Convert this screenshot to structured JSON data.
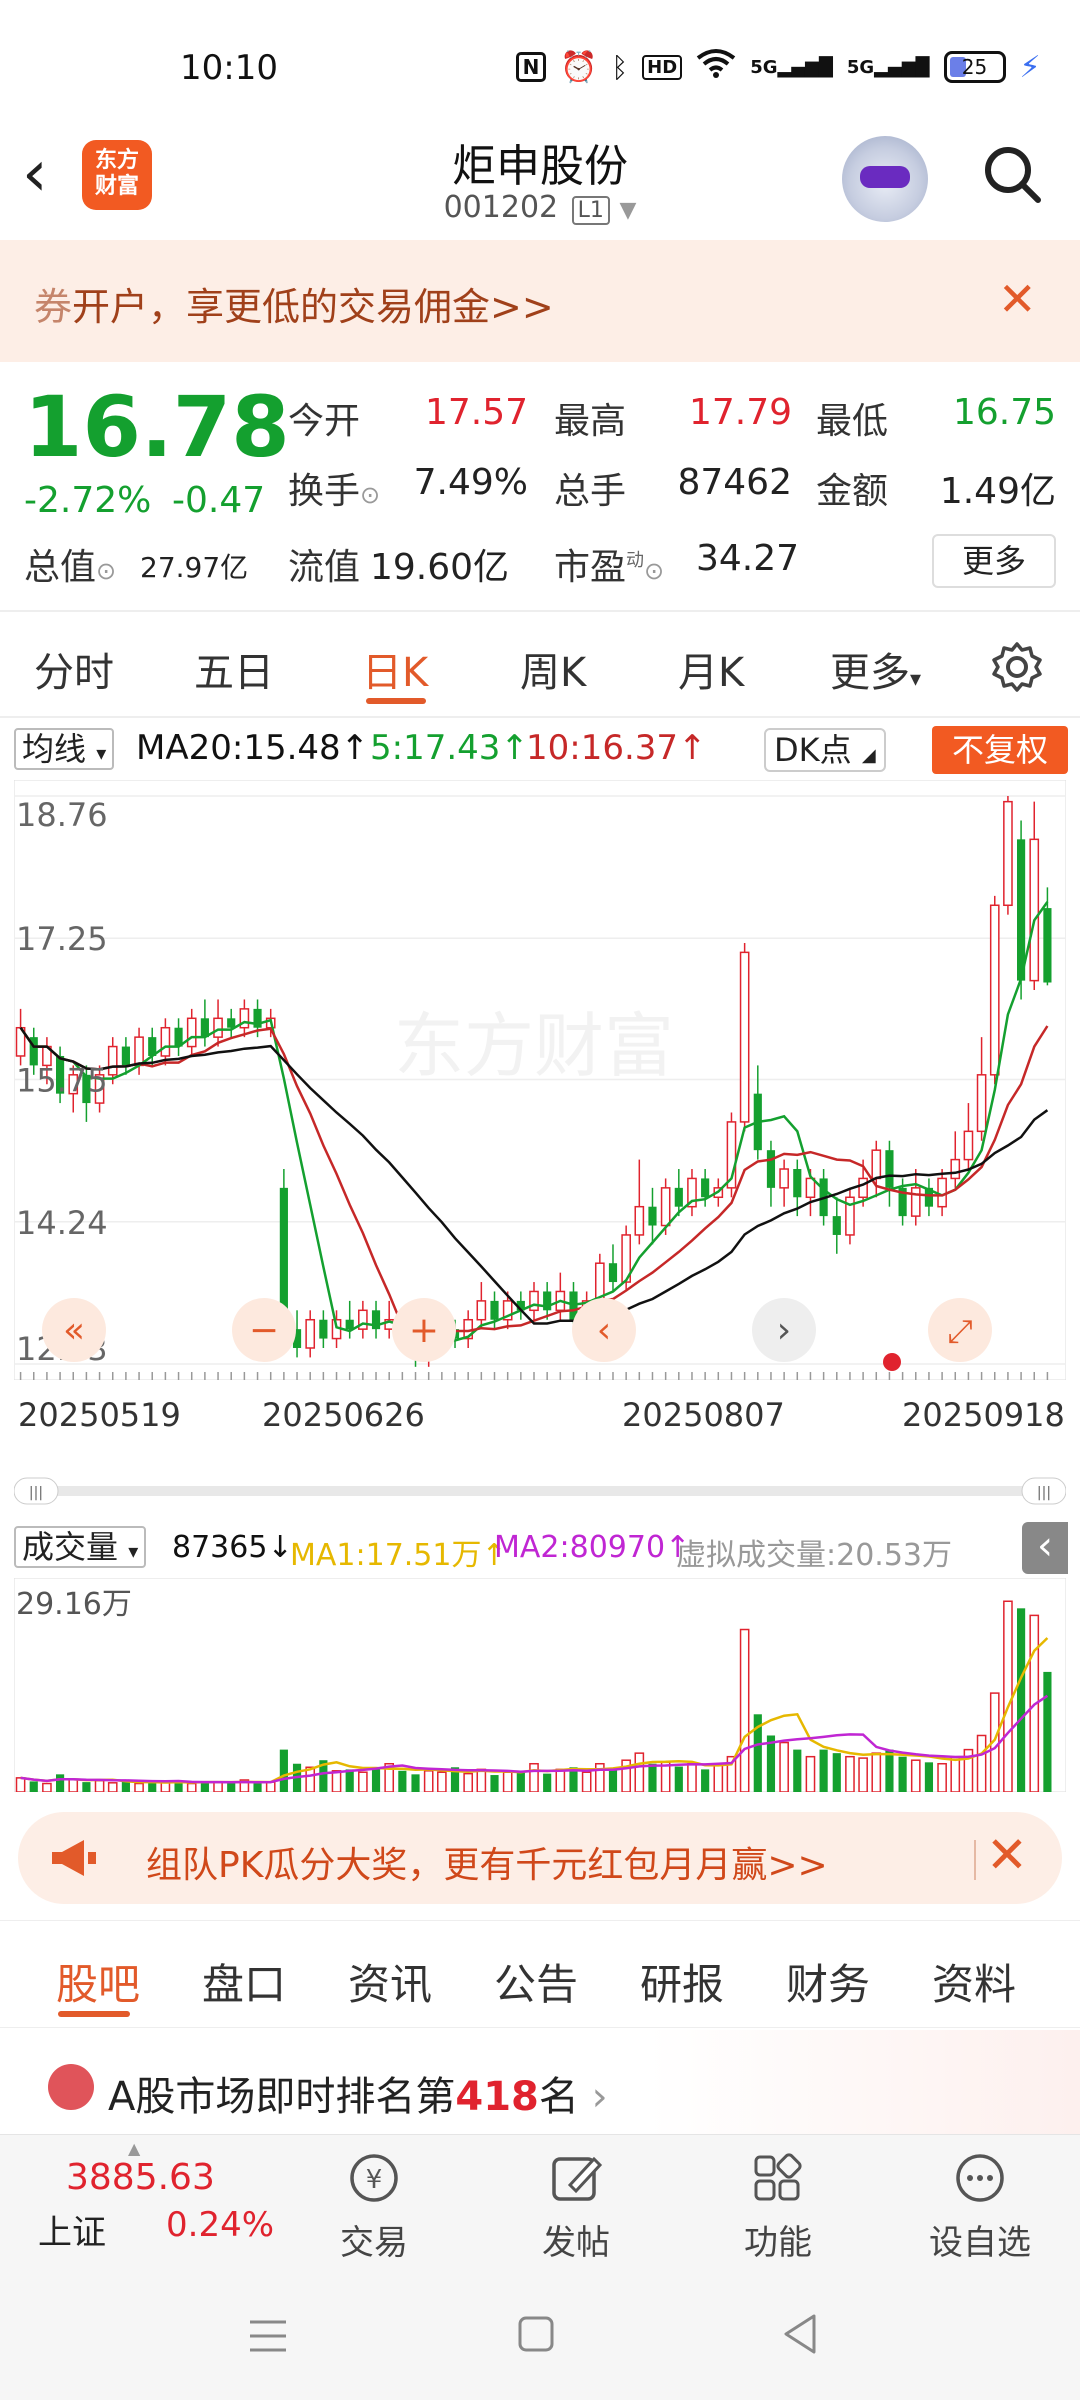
{
  "status_bar": {
    "time": "10:10",
    "battery": "25",
    "network": "5G"
  },
  "header": {
    "back_icon": "chevron-left-icon",
    "logo_text": [
      "东方",
      "财富"
    ],
    "stock_name": "炬申股份",
    "stock_code": "001202",
    "level_badge": "L1",
    "search_icon": "search-icon"
  },
  "banner": {
    "text": "开户，享更低的交易佣金>>",
    "prefix": "券"
  },
  "quote": {
    "price": "16.78",
    "change_pct": "-2.72%",
    "change_abs": "-0.47",
    "open_label": "今开",
    "open": "17.57",
    "high_label": "最高",
    "high": "17.79",
    "low_label": "最低",
    "low": "16.75",
    "turnover_label": "换手",
    "turnover": "7.49%",
    "volume_label": "总手",
    "volume": "87462",
    "amount_label": "金额",
    "amount": "1.49亿",
    "mktcap_label": "总值",
    "mktcap": "27.97亿",
    "float_label": "流值",
    "float": "19.60亿",
    "pe_label": "市盈",
    "pe_sup": "动",
    "pe": "34.27",
    "more_label": "更多"
  },
  "period_tabs": [
    "分时",
    "五日",
    "日K",
    "周K",
    "月K",
    "更多"
  ],
  "active_tab": "日K",
  "ma_bar": {
    "selector": "均线",
    "ma20": "MA20:15.48",
    "ma5": "5:17.43",
    "ma10": "10:16.37",
    "dk": "DK点",
    "adjust": "不复权"
  },
  "kline_axis": {
    "y_labels": [
      "18.76",
      "17.25",
      "15.75",
      "14.24",
      "12.73"
    ],
    "x_labels": [
      "20250519",
      "20250626",
      "20250807",
      "20250918"
    ],
    "watermark": "东方财富"
  },
  "volume_bar": {
    "selector": "成交量",
    "vol": "87365",
    "ma1": "MA1:17.51万",
    "ma2": "MA2:80970",
    "virtual": "虚拟成交量:20.53万",
    "y_max": "29.16万"
  },
  "colors": {
    "up": "#e0232e",
    "down": "#14a02f",
    "ma5": "#14a02f",
    "ma10": "#c62828",
    "ma20": "#111111",
    "vol_ma1": "#e6b800",
    "vol_ma2": "#c026d3",
    "accent": "#f25a22"
  },
  "promo": {
    "text": "组队PK瓜分大奖，更有千元红包月月赢>>"
  },
  "sub_tabs": [
    "股吧",
    "盘口",
    "资讯",
    "公告",
    "研报",
    "财务",
    "资料"
  ],
  "active_sub_tab": "股吧",
  "rank": {
    "prefix": "A股市场即时排名第",
    "number": "418",
    "suffix": "名"
  },
  "bottom_bar": {
    "index_value": "3885.63",
    "index_name": "上证",
    "index_change": "0.24%",
    "buttons": [
      {
        "label": "交易",
        "icon": "trade-icon"
      },
      {
        "label": "发帖",
        "icon": "edit-icon"
      },
      {
        "label": "功能",
        "icon": "grid-icon"
      },
      {
        "label": "设自选",
        "icon": "more-icon"
      }
    ]
  },
  "chart_data": [
    {
      "type": "candlestick",
      "title": "日K",
      "x_range": [
        "20250519",
        "20250918"
      ],
      "ylim": [
        12.73,
        18.76
      ],
      "y_ticks": [
        18.76,
        17.25,
        15.75,
        14.24,
        12.73
      ],
      "candles": [
        {
          "o": 16.0,
          "c": 16.3,
          "h": 16.5,
          "l": 15.9
        },
        {
          "o": 16.2,
          "c": 15.9,
          "h": 16.3,
          "l": 15.8
        },
        {
          "o": 15.9,
          "c": 16.1,
          "h": 16.2,
          "l": 15.7
        },
        {
          "o": 16.0,
          "c": 15.6,
          "h": 16.1,
          "l": 15.5
        },
        {
          "o": 15.6,
          "c": 15.8,
          "h": 15.9,
          "l": 15.4
        },
        {
          "o": 15.8,
          "c": 15.5,
          "h": 15.9,
          "l": 15.3
        },
        {
          "o": 15.5,
          "c": 15.8,
          "h": 15.9,
          "l": 15.4
        },
        {
          "o": 15.8,
          "c": 16.1,
          "h": 16.2,
          "l": 15.7
        },
        {
          "o": 16.1,
          "c": 15.9,
          "h": 16.2,
          "l": 15.8
        },
        {
          "o": 15.9,
          "c": 16.2,
          "h": 16.3,
          "l": 15.8
        },
        {
          "o": 16.2,
          "c": 16.0,
          "h": 16.3,
          "l": 15.9
        },
        {
          "o": 16.0,
          "c": 16.3,
          "h": 16.4,
          "l": 15.9
        },
        {
          "o": 16.3,
          "c": 16.1,
          "h": 16.4,
          "l": 16.0
        },
        {
          "o": 16.1,
          "c": 16.4,
          "h": 16.5,
          "l": 16.0
        },
        {
          "o": 16.4,
          "c": 16.2,
          "h": 16.6,
          "l": 16.1
        },
        {
          "o": 16.2,
          "c": 16.4,
          "h": 16.6,
          "l": 16.1
        },
        {
          "o": 16.4,
          "c": 16.3,
          "h": 16.5,
          "l": 16.2
        },
        {
          "o": 16.3,
          "c": 16.5,
          "h": 16.6,
          "l": 16.2
        },
        {
          "o": 16.5,
          "c": 16.3,
          "h": 16.6,
          "l": 16.2
        },
        {
          "o": 16.3,
          "c": 16.4,
          "h": 16.5,
          "l": 16.2
        },
        {
          "o": 14.6,
          "c": 13.3,
          "h": 14.8,
          "l": 13.1
        },
        {
          "o": 13.1,
          "c": 12.9,
          "h": 13.3,
          "l": 12.8
        },
        {
          "o": 12.9,
          "c": 13.2,
          "h": 13.3,
          "l": 12.8
        },
        {
          "o": 13.2,
          "c": 13.0,
          "h": 13.3,
          "l": 12.9
        },
        {
          "o": 13.0,
          "c": 13.2,
          "h": 13.3,
          "l": 12.9
        },
        {
          "o": 13.2,
          "c": 13.1,
          "h": 13.4,
          "l": 13.0
        },
        {
          "o": 13.1,
          "c": 13.3,
          "h": 13.4,
          "l": 13.0
        },
        {
          "o": 13.3,
          "c": 13.1,
          "h": 13.4,
          "l": 13.0
        },
        {
          "o": 13.1,
          "c": 13.2,
          "h": 13.4,
          "l": 13.0
        },
        {
          "o": 13.2,
          "c": 13.0,
          "h": 13.3,
          "l": 12.9
        },
        {
          "o": 13.0,
          "c": 12.8,
          "h": 13.1,
          "l": 12.7
        },
        {
          "o": 12.8,
          "c": 13.0,
          "h": 13.1,
          "l": 12.7
        },
        {
          "o": 13.0,
          "c": 13.1,
          "h": 13.2,
          "l": 12.9
        },
        {
          "o": 13.1,
          "c": 13.0,
          "h": 13.2,
          "l": 12.9
        },
        {
          "o": 13.0,
          "c": 13.2,
          "h": 13.3,
          "l": 12.9
        },
        {
          "o": 13.2,
          "c": 13.4,
          "h": 13.6,
          "l": 13.1
        },
        {
          "o": 13.4,
          "c": 13.2,
          "h": 13.5,
          "l": 13.1
        },
        {
          "o": 13.2,
          "c": 13.4,
          "h": 13.5,
          "l": 13.1
        },
        {
          "o": 13.4,
          "c": 13.3,
          "h": 13.5,
          "l": 13.2
        },
        {
          "o": 13.3,
          "c": 13.5,
          "h": 13.6,
          "l": 13.2
        },
        {
          "o": 13.5,
          "c": 13.3,
          "h": 13.6,
          "l": 13.2
        },
        {
          "o": 13.3,
          "c": 13.5,
          "h": 13.7,
          "l": 13.2
        },
        {
          "o": 13.5,
          "c": 13.2,
          "h": 13.6,
          "l": 13.1
        },
        {
          "o": 13.2,
          "c": 13.4,
          "h": 13.5,
          "l": 13.1
        },
        {
          "o": 13.4,
          "c": 13.8,
          "h": 13.9,
          "l": 13.3
        },
        {
          "o": 13.8,
          "c": 13.6,
          "h": 14.0,
          "l": 13.5
        },
        {
          "o": 13.6,
          "c": 14.1,
          "h": 14.2,
          "l": 13.5
        },
        {
          "o": 14.1,
          "c": 14.4,
          "h": 14.9,
          "l": 14.0
        },
        {
          "o": 14.4,
          "c": 14.2,
          "h": 14.6,
          "l": 14.0
        },
        {
          "o": 14.2,
          "c": 14.6,
          "h": 14.7,
          "l": 14.1
        },
        {
          "o": 14.6,
          "c": 14.4,
          "h": 14.8,
          "l": 14.3
        },
        {
          "o": 14.4,
          "c": 14.7,
          "h": 14.8,
          "l": 14.3
        },
        {
          "o": 14.7,
          "c": 14.5,
          "h": 14.8,
          "l": 14.4
        },
        {
          "o": 14.5,
          "c": 14.6,
          "h": 14.7,
          "l": 14.4
        },
        {
          "o": 14.6,
          "c": 15.3,
          "h": 15.4,
          "l": 14.5
        },
        {
          "o": 15.3,
          "c": 17.1,
          "h": 17.2,
          "l": 15.2
        },
        {
          "o": 15.6,
          "c": 15.0,
          "h": 15.9,
          "l": 14.9
        },
        {
          "o": 15.0,
          "c": 14.6,
          "h": 15.1,
          "l": 14.4
        },
        {
          "o": 14.6,
          "c": 14.8,
          "h": 14.9,
          "l": 14.4
        },
        {
          "o": 14.8,
          "c": 14.5,
          "h": 14.9,
          "l": 14.3
        },
        {
          "o": 14.5,
          "c": 14.7,
          "h": 14.8,
          "l": 14.3
        },
        {
          "o": 14.7,
          "c": 14.3,
          "h": 14.8,
          "l": 14.2
        },
        {
          "o": 14.3,
          "c": 14.1,
          "h": 14.5,
          "l": 13.9
        },
        {
          "o": 14.1,
          "c": 14.5,
          "h": 14.6,
          "l": 14.0
        },
        {
          "o": 14.5,
          "c": 14.7,
          "h": 14.9,
          "l": 14.4
        },
        {
          "o": 14.7,
          "c": 15.0,
          "h": 15.1,
          "l": 14.5
        },
        {
          "o": 15.0,
          "c": 14.6,
          "h": 15.1,
          "l": 14.4
        },
        {
          "o": 14.6,
          "c": 14.3,
          "h": 14.7,
          "l": 14.2
        },
        {
          "o": 14.3,
          "c": 14.6,
          "h": 14.8,
          "l": 14.2
        },
        {
          "o": 14.6,
          "c": 14.4,
          "h": 14.7,
          "l": 14.3
        },
        {
          "o": 14.4,
          "c": 14.7,
          "h": 14.8,
          "l": 14.3
        },
        {
          "o": 14.7,
          "c": 14.9,
          "h": 15.2,
          "l": 14.6
        },
        {
          "o": 14.9,
          "c": 15.2,
          "h": 15.5,
          "l": 14.8
        },
        {
          "o": 15.2,
          "c": 15.8,
          "h": 16.2,
          "l": 15.1
        },
        {
          "o": 15.8,
          "c": 17.6,
          "h": 17.7,
          "l": 15.7
        },
        {
          "o": 17.6,
          "c": 18.7,
          "h": 18.76,
          "l": 17.5
        },
        {
          "o": 18.3,
          "c": 16.8,
          "h": 18.5,
          "l": 16.6
        },
        {
          "o": 16.8,
          "c": 18.3,
          "h": 18.7,
          "l": 16.7
        },
        {
          "o": 17.57,
          "c": 16.78,
          "h": 17.79,
          "l": 16.75
        }
      ],
      "ma5_label": "MA5 17.43",
      "ma10_label": "MA10 16.37",
      "ma20_label": "MA20 15.48"
    },
    {
      "type": "bar",
      "title": "成交量",
      "ylim": [
        0,
        291600
      ],
      "values": [
        2,
        1.5,
        1.2,
        2.5,
        1.8,
        1.4,
        1.6,
        1.3,
        1.5,
        1.2,
        1.4,
        1.3,
        1.6,
        1.2,
        1.5,
        1.4,
        1.3,
        1.7,
        1.2,
        1.4,
        6,
        4,
        3.5,
        4.5,
        3,
        3.2,
        2.8,
        3.5,
        4,
        3,
        2.5,
        3,
        2.8,
        3.5,
        2.6,
        3.2,
        2.4,
        2.8,
        3,
        4,
        2.6,
        3.2,
        3.5,
        2.8,
        4,
        3.2,
        4.5,
        5.5,
        4,
        4.2,
        3.6,
        4,
        3.2,
        3.8,
        5,
        23,
        11,
        8,
        7,
        6,
        5,
        6,
        5.5,
        5,
        4.8,
        5.5,
        6,
        5,
        4.5,
        4.2,
        4,
        5,
        6,
        8,
        14,
        27,
        26,
        25,
        17
      ]
    }
  ]
}
